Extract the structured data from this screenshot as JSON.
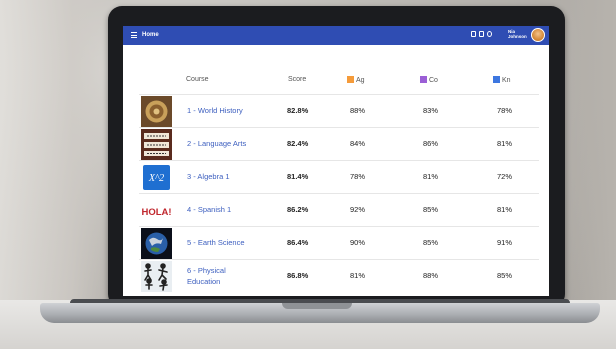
{
  "app": {
    "title": "Home"
  },
  "user": {
    "name_line1": "Nia",
    "name_line2": "Johnson"
  },
  "columns": {
    "course": "Course",
    "score": "Score",
    "legend": [
      {
        "label": "Ag",
        "color": "#f59b3a"
      },
      {
        "label": "Co",
        "color": "#9b5fd6"
      },
      {
        "label": "Kn",
        "color": "#3d77e0"
      }
    ]
  },
  "courses": [
    {
      "name": "1 - World History",
      "score": "82.8%",
      "ag": "88%",
      "co": "83%",
      "kn": "78%",
      "icon": "world-history-thumb"
    },
    {
      "name": "2 - Language Arts",
      "score": "82.4%",
      "ag": "84%",
      "co": "86%",
      "kn": "81%",
      "icon": "language-arts-thumb"
    },
    {
      "name": "3 - Algebra 1",
      "score": "81.4%",
      "ag": "78%",
      "co": "81%",
      "kn": "72%",
      "icon": "algebra-thumb"
    },
    {
      "name": "4 - Spanish 1",
      "score": "86.2%",
      "ag": "92%",
      "co": "85%",
      "kn": "81%",
      "icon": "spanish-thumb"
    },
    {
      "name": "5 - Earth Science",
      "score": "86.4%",
      "ag": "90%",
      "co": "85%",
      "kn": "91%",
      "icon": "earth-science-thumb"
    },
    {
      "name": "6 - Physical Education",
      "name_line1": "6 - Physical",
      "name_line2": "Education",
      "score": "86.8%",
      "ag": "81%",
      "co": "88%",
      "kn": "85%",
      "icon": "physical-education-thumb"
    }
  ],
  "thumb_texts": {
    "algebra": "X^2",
    "spanish": "HOLA!"
  }
}
